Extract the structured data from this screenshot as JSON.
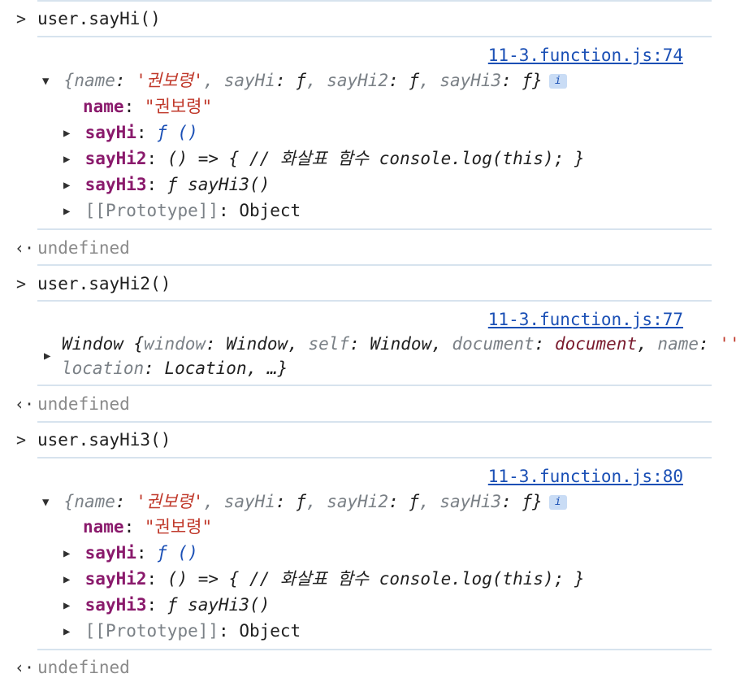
{
  "entries": [
    {
      "command": "user.sayHi()",
      "source": "11-3.function.js:74",
      "object": {
        "preview": {
          "name_key": "name",
          "name_val": "'권보령'",
          "p1": "sayHi",
          "p2": "sayHi2",
          "p3": "sayHi3",
          "fval": "ƒ"
        },
        "name_label": "name",
        "name_value": "\"권보령\"",
        "sayHi_label": "sayHi",
        "sayHi_value": "ƒ ()",
        "sayHi2_label": "sayHi2",
        "sayHi2_value": "() => { // 화살표 함수 console.log(this); }",
        "sayHi3_label": "sayHi3",
        "sayHi3_value": "ƒ sayHi3()",
        "proto_label": "[[Prototype]]",
        "proto_value": "Object"
      },
      "result": "undefined"
    },
    {
      "command": "user.sayHi2()",
      "source": "11-3.function.js:77",
      "window": {
        "label": "Window",
        "k1": "window",
        "v1": "Window",
        "k2": "self",
        "v2": "Window",
        "k3": "document",
        "v3": "document",
        "k4": "name",
        "v4": "''",
        "k5": "location",
        "v5": "Location",
        "more": "…"
      },
      "result": "undefined"
    },
    {
      "command": "user.sayHi3()",
      "source": "11-3.function.js:80",
      "object": {
        "preview": {
          "name_key": "name",
          "name_val": "'권보령'",
          "p1": "sayHi",
          "p2": "sayHi2",
          "p3": "sayHi3",
          "fval": "ƒ"
        },
        "name_label": "name",
        "name_value": "\"권보령\"",
        "sayHi_label": "sayHi",
        "sayHi_value": "ƒ ()",
        "sayHi2_label": "sayHi2",
        "sayHi2_value": "() => { // 화살표 함수 console.log(this); }",
        "sayHi3_label": "sayHi3",
        "sayHi3_value": "ƒ sayHi3()",
        "proto_label": "[[Prototype]]",
        "proto_value": "Object"
      },
      "result": "undefined"
    }
  ],
  "info_badge": "i",
  "icons": {
    "prompt": "chevron-right-icon",
    "result": "return-arrow-icon",
    "expanded": "triangle-down-icon",
    "collapsed": "triangle-right-icon"
  }
}
